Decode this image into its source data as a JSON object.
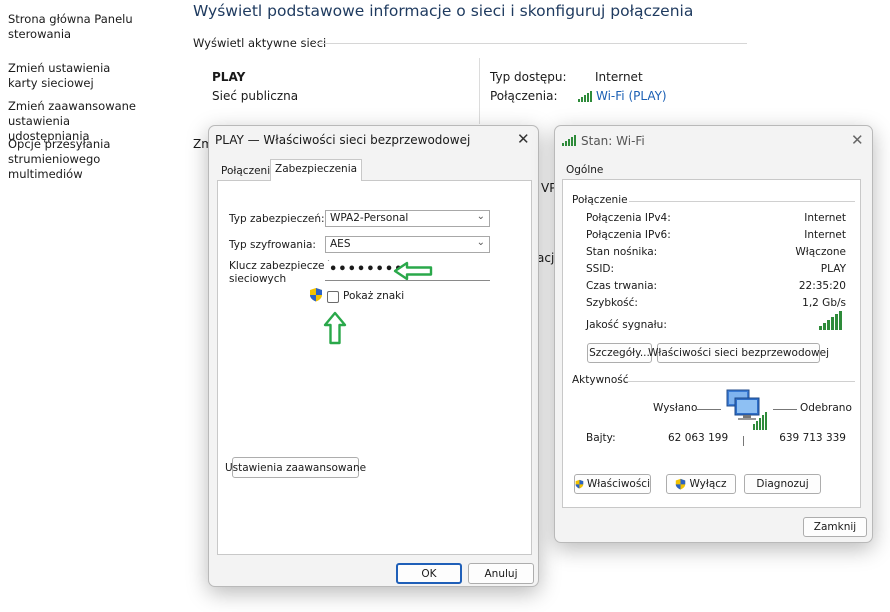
{
  "sidebar": {
    "items": [
      "Strona główna Panelu sterowania",
      "Zmień ustawienia karty sieciowej",
      "Zmień zaawansowane ustawienia udostępniania",
      "Opcje przesyłania strumieniowego multimediów"
    ]
  },
  "main": {
    "title": "Wyświetl podstawowe informacje o sieci i skonfiguruj połączenia",
    "active_networks_label": "Wyświetl aktywne sieci",
    "network_name": "PLAY",
    "network_type": "Sieć publiczna",
    "access_type_label": "Typ dostępu:",
    "access_type_value": "Internet",
    "connections_label": "Połączenia:",
    "connections_value": "Wi-Fi (PLAY)",
    "frag_zm": "Zm",
    "frag_vp": "VP",
    "frag_acj": "acj"
  },
  "props_dialog": {
    "title": "PLAY — Właściwości sieci bezprzewodowej",
    "tabs": [
      "Połączenie",
      "Zabezpieczenia"
    ],
    "security_type_label": "Typ zabezpieczeń:",
    "security_type_value": "WPA2-Personal",
    "encryption_type_label": "Typ szyfrowania:",
    "encryption_type_value": "AES",
    "key_label_line1": "Klucz zabezpieczeń",
    "key_label_line2": "sieciowych",
    "key_value": "••••••••",
    "show_chars_label": "Pokaż znaki",
    "advanced_button": "Ustawienia zaawansowane",
    "ok_button": "OK",
    "cancel_button": "Anuluj"
  },
  "status_dialog": {
    "title": "Stan: Wi-Fi",
    "tab": "Ogólne",
    "connection_group": "Połączenie",
    "rows": [
      {
        "label": "Połączenia IPv4:",
        "value": "Internet"
      },
      {
        "label": "Połączenia IPv6:",
        "value": "Internet"
      },
      {
        "label": "Stan nośnika:",
        "value": "Włączone"
      },
      {
        "label": "SSID:",
        "value": "PLAY"
      },
      {
        "label": "Czas trwania:",
        "value": "22:35:20"
      },
      {
        "label": "Szybkość:",
        "value": "1,2 Gb/s"
      }
    ],
    "signal_label": "Jakość sygnału:",
    "details_button": "Szczegóły...",
    "wireless_props_button": "Właściwości sieci bezprzewodowej",
    "activity_group": "Aktywność",
    "sent_label": "Wysłano",
    "received_label": "Odebrano",
    "bytes_label": "Bajty:",
    "bytes_sent": "62 063 199",
    "bytes_received": "639 713 339",
    "properties_button": "Właściwości",
    "disable_button": "Wyłącz",
    "diagnose_button": "Diagnozuj",
    "close_button": "Zamknij"
  },
  "colors": {
    "accent": "#1f5fb8",
    "arrow_green": "#2aa84a",
    "signal_green": "#2e8b3a"
  }
}
